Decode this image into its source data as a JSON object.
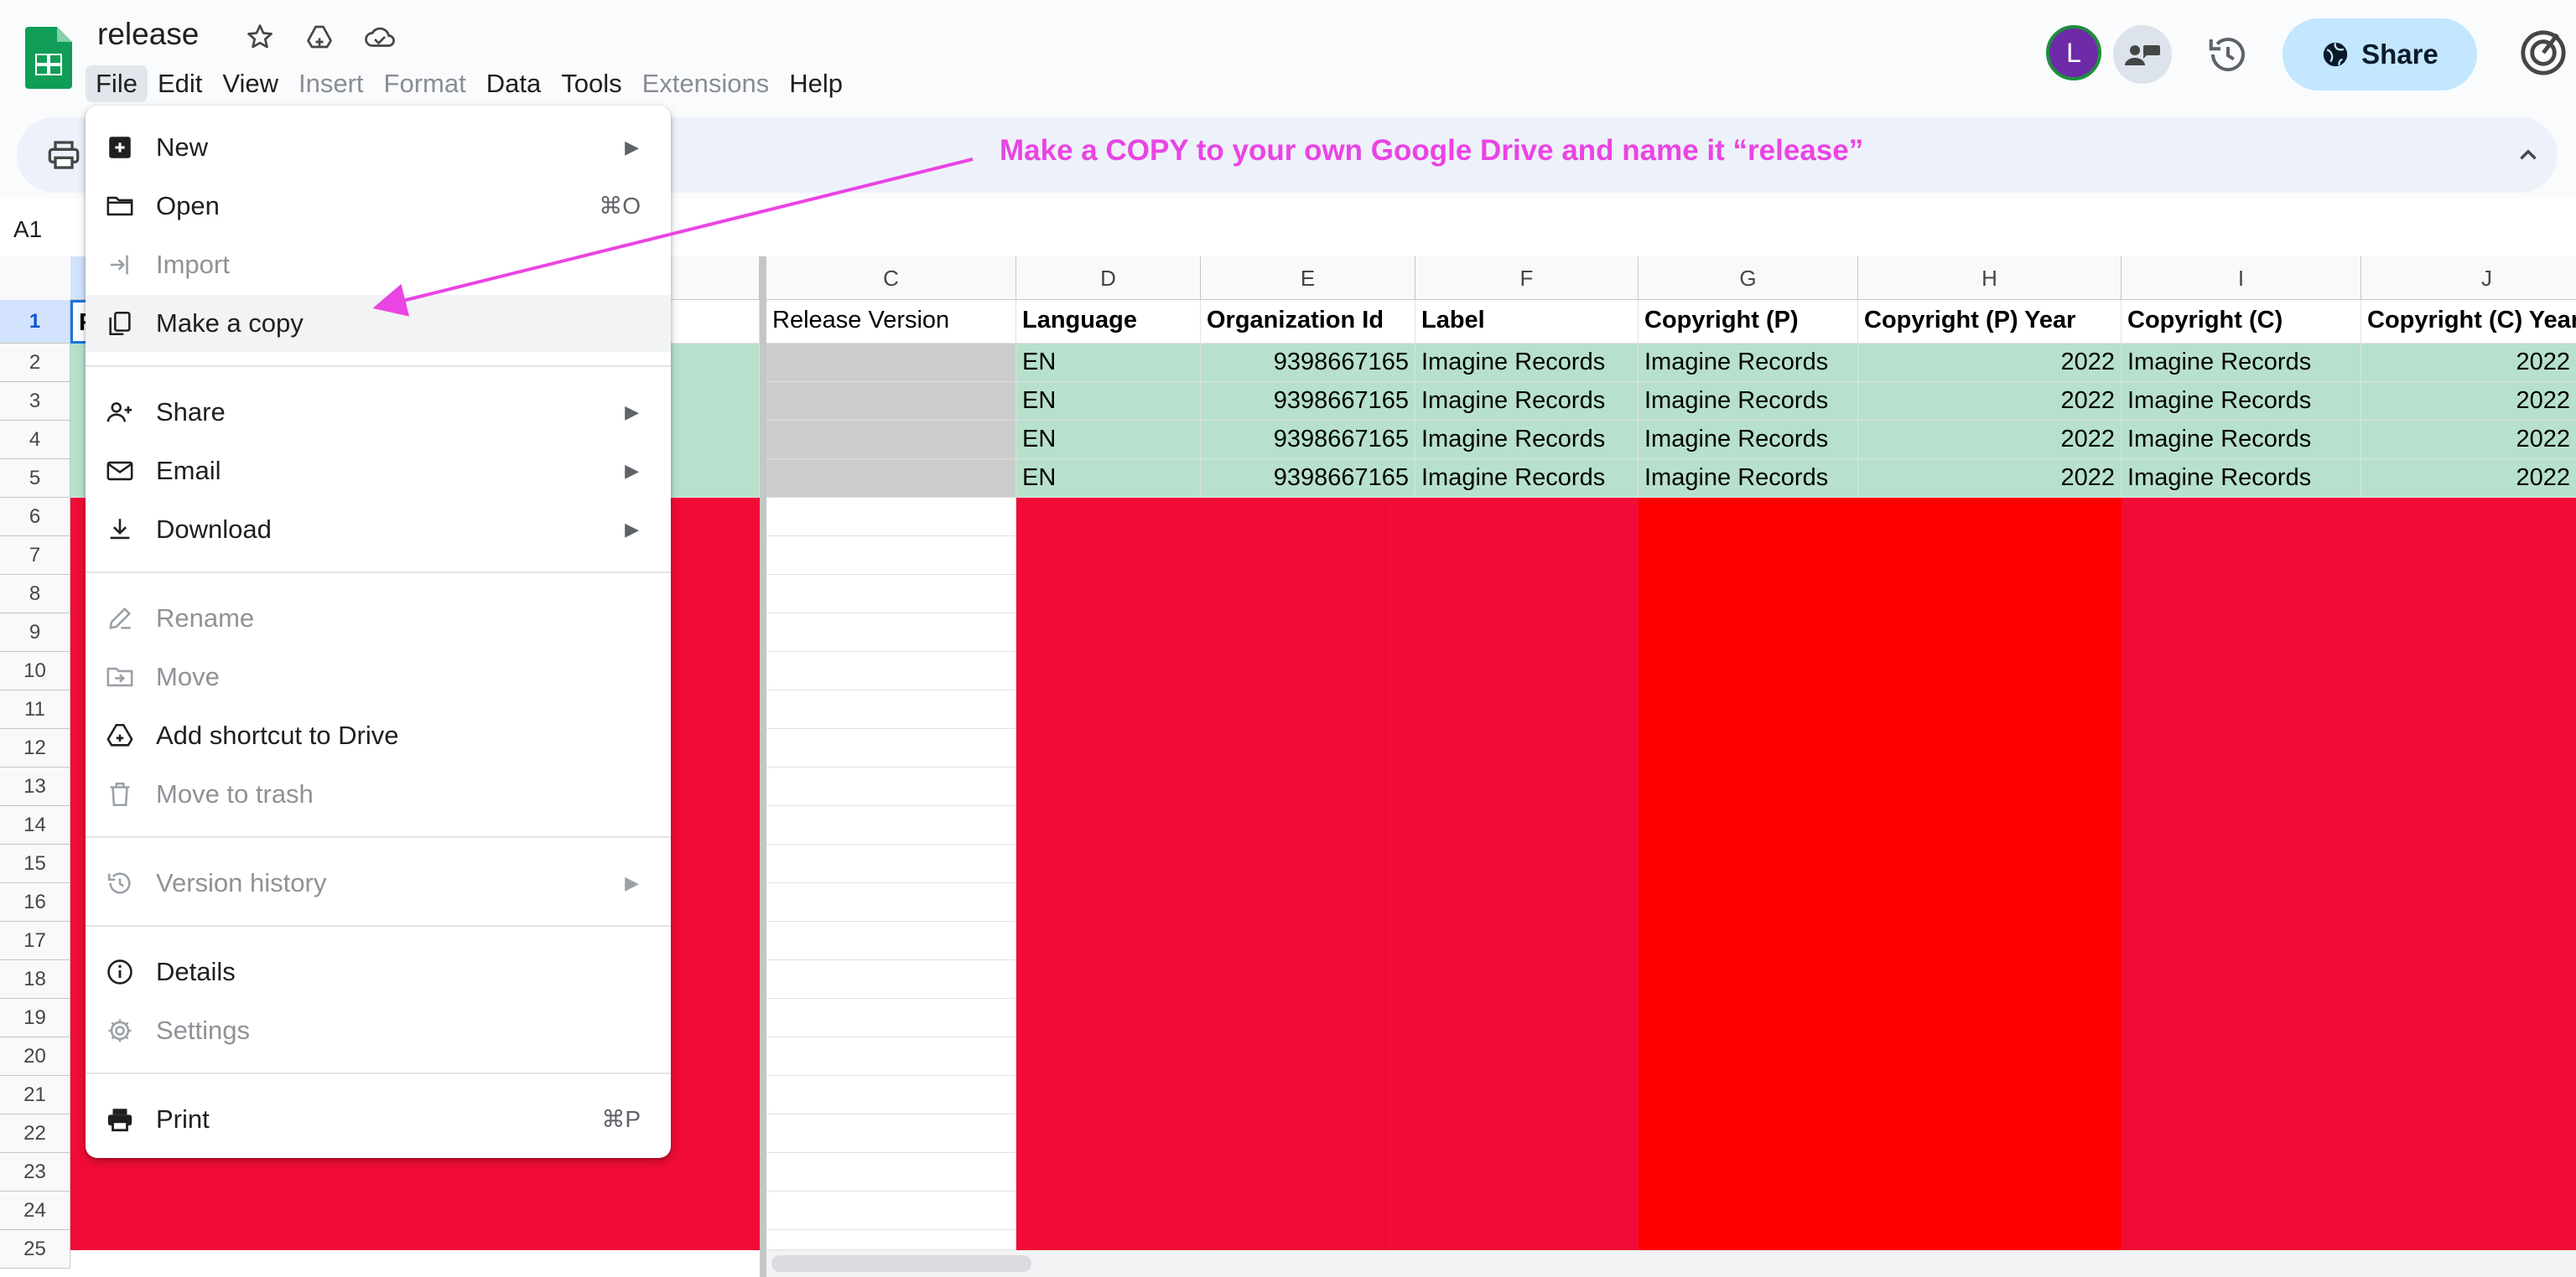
{
  "doc": {
    "title": "release",
    "icons": [
      "star-icon",
      "move-to-drive-icon",
      "cloud-saved-icon"
    ]
  },
  "menubar": [
    {
      "label": "File",
      "enabled": true,
      "active": true
    },
    {
      "label": "Edit",
      "enabled": true
    },
    {
      "label": "View",
      "enabled": true
    },
    {
      "label": "Insert",
      "enabled": false
    },
    {
      "label": "Format",
      "enabled": false
    },
    {
      "label": "Data",
      "enabled": true
    },
    {
      "label": "Tools",
      "enabled": true
    },
    {
      "label": "Extensions",
      "enabled": false
    },
    {
      "label": "Help",
      "enabled": true
    }
  ],
  "header_right": {
    "avatar_initial": "L",
    "share_label": "Share"
  },
  "annotation": {
    "text": "Make a COPY to your own Google Drive and name it “release”",
    "color": "#ea44e3"
  },
  "formula_bar": {
    "name_box": "A1"
  },
  "file_menu": {
    "sections": [
      [
        {
          "label": "New",
          "icon": "new-sheet-icon",
          "submenu": true
        },
        {
          "label": "Open",
          "icon": "folder-open-icon",
          "shortcut": "⌘O"
        },
        {
          "label": "Import",
          "icon": "import-icon",
          "disabled": true
        },
        {
          "label": "Make a copy",
          "icon": "copy-icon",
          "highlighted": true
        }
      ],
      [
        {
          "label": "Share",
          "icon": "person-add-icon",
          "submenu": true
        },
        {
          "label": "Email",
          "icon": "mail-icon",
          "submenu": true
        },
        {
          "label": "Download",
          "icon": "download-icon",
          "submenu": true
        }
      ],
      [
        {
          "label": "Rename",
          "icon": "rename-icon",
          "disabled": true
        },
        {
          "label": "Move",
          "icon": "move-folder-icon",
          "disabled": true
        },
        {
          "label": "Add shortcut to Drive",
          "icon": "drive-shortcut-icon"
        },
        {
          "label": "Move to trash",
          "icon": "trash-icon",
          "disabled": true
        }
      ],
      [
        {
          "label": "Version history",
          "icon": "history-icon",
          "disabled": true,
          "submenu": true
        }
      ],
      [
        {
          "label": "Details",
          "icon": "info-icon"
        },
        {
          "label": "Settings",
          "icon": "settings-icon",
          "disabled": true
        }
      ],
      [
        {
          "label": "Print",
          "icon": "print-icon",
          "shortcut": "⌘P"
        }
      ]
    ]
  },
  "sheet": {
    "visible_columns": [
      "C",
      "D",
      "E",
      "F",
      "G",
      "H",
      "I",
      "J"
    ],
    "row_numbers": [
      "1",
      "2",
      "3",
      "4",
      "5",
      "6",
      "7",
      "8",
      "9",
      "10",
      "11",
      "12",
      "13",
      "14",
      "15",
      "16",
      "17",
      "18",
      "19",
      "20",
      "21",
      "22",
      "23",
      "24",
      "25"
    ],
    "a1_partial": "R",
    "header_row": [
      "Release Version",
      "Language",
      "Organization Id",
      "Label",
      "Copyright (P)",
      "Copyright (P) Year",
      "Copyright (C)",
      "Copyright (C) Year"
    ],
    "data_rows": [
      [
        "",
        "EN",
        "9398667165",
        "Imagine Records",
        "Imagine Records",
        "2022",
        "Imagine Records",
        "2022"
      ],
      [
        "",
        "EN",
        "9398667165",
        "Imagine Records",
        "Imagine Records",
        "2022",
        "Imagine Records",
        "2022"
      ],
      [
        "",
        "EN",
        "9398667165",
        "Imagine Records",
        "Imagine Records",
        "2022",
        "Imagine Records",
        "2022"
      ],
      [
        "",
        "EN",
        "9398667165",
        "Imagine Records",
        "Imagine Records",
        "2022",
        "Imagine Records",
        "2022"
      ]
    ],
    "fill_colors": {
      "filled_row": "#b7e1cd",
      "empty_version": "#cccccc",
      "invalid": "#f00c37",
      "invalid_bright": "#ff0000"
    }
  }
}
